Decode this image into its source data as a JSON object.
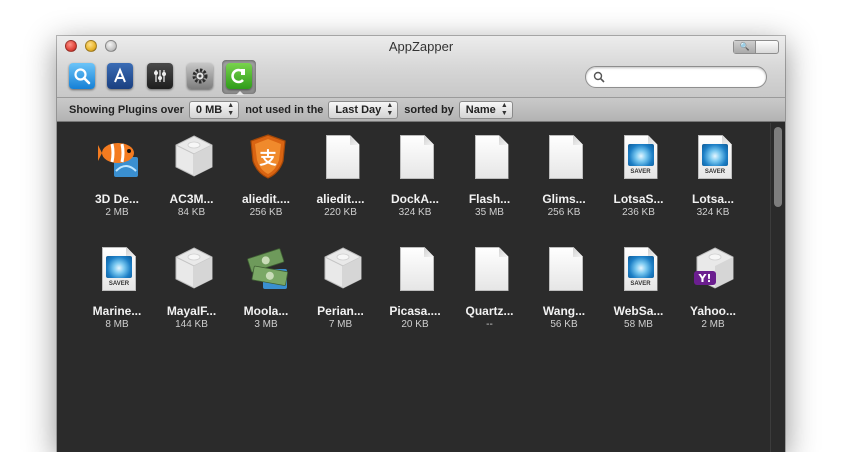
{
  "window": {
    "title": "AppZapper"
  },
  "toolbar": {
    "buttons": [
      {
        "name": "apps",
        "icon": "magnifier-app-icon"
      },
      {
        "name": "widgets",
        "icon": "app-store-icon"
      },
      {
        "name": "prefpanes",
        "icon": "mixer-icon"
      },
      {
        "name": "settings",
        "icon": "gear-icon"
      },
      {
        "name": "plugins",
        "icon": "plugin-icon",
        "selected": true
      }
    ],
    "search_placeholder": ""
  },
  "filter": {
    "prefix": "Showing Plugins over",
    "size_value": "0 MB",
    "middle": "not used in the",
    "time_value": "Last Day",
    "sort_prefix": "sorted by",
    "sort_value": "Name"
  },
  "items": [
    {
      "name": "3D De...",
      "size": "2 MB",
      "icon": "clownfish"
    },
    {
      "name": "AC3M...",
      "size": "84 KB",
      "icon": "cube"
    },
    {
      "name": "aliedit....",
      "size": "256 KB",
      "icon": "shield"
    },
    {
      "name": "aliedit....",
      "size": "220 KB",
      "icon": "doc"
    },
    {
      "name": "DockA...",
      "size": "324 KB",
      "icon": "doc"
    },
    {
      "name": "Flash...",
      "size": "35 MB",
      "icon": "doc"
    },
    {
      "name": "Glims...",
      "size": "256 KB",
      "icon": "doc"
    },
    {
      "name": "LotsaS...",
      "size": "236 KB",
      "icon": "saver"
    },
    {
      "name": "Lotsa...",
      "size": "324 KB",
      "icon": "saver"
    },
    {
      "name": "Marine...",
      "size": "8 MB",
      "icon": "saver"
    },
    {
      "name": "MayaIF...",
      "size": "144 KB",
      "icon": "cube"
    },
    {
      "name": "Moola...",
      "size": "3 MB",
      "icon": "money"
    },
    {
      "name": "Perian...",
      "size": "7 MB",
      "icon": "cube"
    },
    {
      "name": "Picasa....",
      "size": "20 KB",
      "icon": "doc"
    },
    {
      "name": "Quartz...",
      "size": "--",
      "icon": "doc"
    },
    {
      "name": "Wang...",
      "size": "56 KB",
      "icon": "doc"
    },
    {
      "name": "WebSa...",
      "size": "58 MB",
      "icon": "saver"
    },
    {
      "name": "Yahoo...",
      "size": "2 MB",
      "icon": "yahoo"
    }
  ],
  "saver_text": "SAVER",
  "yahoo_text": "Y!",
  "shield_text": "支",
  "colors": {
    "grid_bg": "#2b2b2b",
    "shield": "#ee7a1c",
    "yahoo": "#6b1e8f"
  }
}
